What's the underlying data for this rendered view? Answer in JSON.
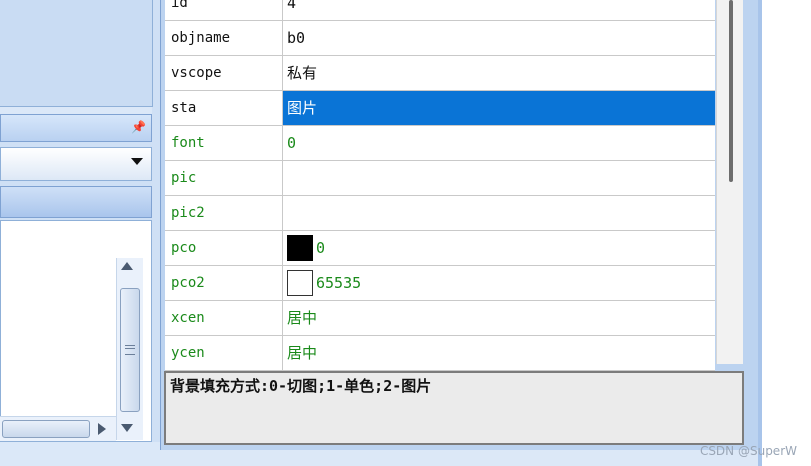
{
  "properties": [
    {
      "name": "id",
      "value": "4",
      "style": "normal"
    },
    {
      "name": "objname",
      "value": "b0",
      "style": "normal"
    },
    {
      "name": "vscope",
      "value": "私有",
      "style": "normal"
    },
    {
      "name": "sta",
      "value": "图片",
      "style": "selected"
    },
    {
      "name": "font",
      "value": "0",
      "style": "green"
    },
    {
      "name": "pic",
      "value": "",
      "style": "green"
    },
    {
      "name": "pic2",
      "value": "",
      "style": "green"
    },
    {
      "name": "pco",
      "value": "0",
      "style": "green",
      "swatch": "black"
    },
    {
      "name": "pco2",
      "value": "65535",
      "style": "green",
      "swatch": "white"
    },
    {
      "name": "xcen",
      "value": "居中",
      "style": "green"
    },
    {
      "name": "ycen",
      "value": "居中",
      "style": "green"
    }
  ],
  "description": "背景填充方式:0-切图;1-单色;2-图片",
  "watermark": "CSDN @SuperW",
  "icons": {
    "pin": "pin-icon",
    "dropdown": "chevron-down-icon"
  },
  "colors": {
    "selection": "#0a74d6",
    "property_green": "#1a8a1a"
  }
}
